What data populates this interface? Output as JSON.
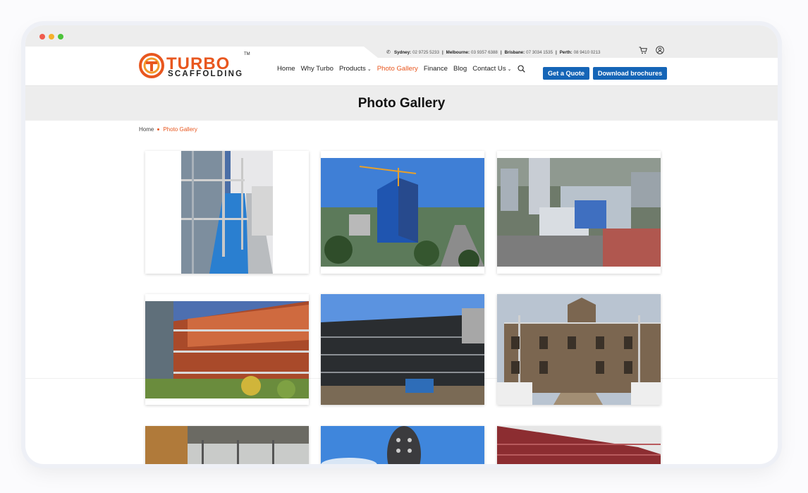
{
  "topbar": {
    "contacts": [
      {
        "city": "Sydney:",
        "phone": "02 9725 5233"
      },
      {
        "city": "Melbourne:",
        "phone": "03 9357 6388"
      },
      {
        "city": "Brisbane:",
        "phone": "07 3034 1535"
      },
      {
        "city": "Perth:",
        "phone": "08 9410 0213"
      }
    ],
    "separator": "|",
    "icons": [
      "phone-icon",
      "cart-icon",
      "user-icon"
    ]
  },
  "logo": {
    "line1": "TURBO",
    "line2": "SCAFFOLDING",
    "tm": "TM"
  },
  "nav": {
    "items": [
      {
        "label": "Home",
        "dropdown": false
      },
      {
        "label": "Why Turbo",
        "dropdown": false
      },
      {
        "label": "Products",
        "dropdown": true
      },
      {
        "label": "Photo Gallery",
        "dropdown": false,
        "active": true
      },
      {
        "label": "Finance",
        "dropdown": false
      },
      {
        "label": "Blog",
        "dropdown": false
      },
      {
        "label": "Contact Us",
        "dropdown": true
      }
    ],
    "quote_label": "Get a Quote",
    "brochure_label": "Download brochures"
  },
  "page": {
    "title": "Photo Gallery"
  },
  "breadcrumb": {
    "home": "Home",
    "current": "Photo Gallery"
  },
  "gallery": {
    "photos": [
      {
        "name": "scaffold-walkway-photo"
      },
      {
        "name": "highrise-tower-crane-photo"
      },
      {
        "name": "aerial-city-site-photo"
      },
      {
        "name": "brick-facade-scaffold-photo"
      },
      {
        "name": "building-netting-scaffold-photo"
      },
      {
        "name": "heritage-building-scaffold-photo"
      },
      {
        "name": "roof-structure-photo"
      },
      {
        "name": "tower-structure-photo"
      },
      {
        "name": "red-roof-building-photo"
      }
    ]
  },
  "colors": {
    "brand_orange": "#e8571f",
    "button_blue": "#1565b7",
    "band_grey": "#ededed"
  }
}
